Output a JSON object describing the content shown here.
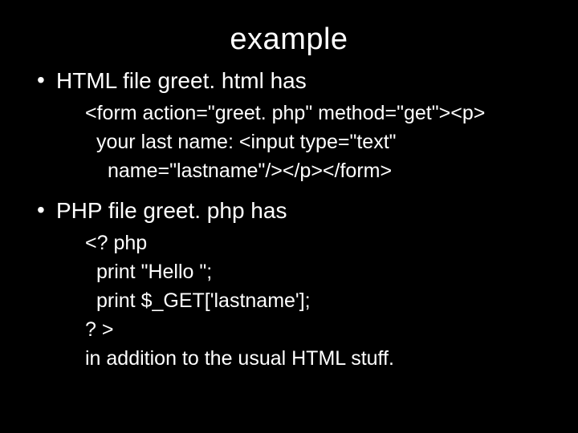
{
  "title": "example",
  "bullets": [
    {
      "text": "HTML file greet. html has",
      "code": [
        {
          "text": "<form action=\"greet. php\" method=\"get\"><p>",
          "indent": 0
        },
        {
          "text": "your last name: <input type=\"text\"",
          "indent": 1
        },
        {
          "text": "name=\"lastname\"/></p></form>",
          "indent": 2
        }
      ]
    },
    {
      "text": "PHP file greet. php has",
      "code": [
        {
          "text": "<? php",
          "indent": 0
        },
        {
          "text": "print \"Hello \";",
          "indent": 1
        },
        {
          "text": "print $_GET['lastname'];",
          "indent": 1
        },
        {
          "text": "? >",
          "indent": 0
        },
        {
          "text": "in addition to the usual HTML stuff.",
          "indent": 0
        }
      ]
    }
  ]
}
